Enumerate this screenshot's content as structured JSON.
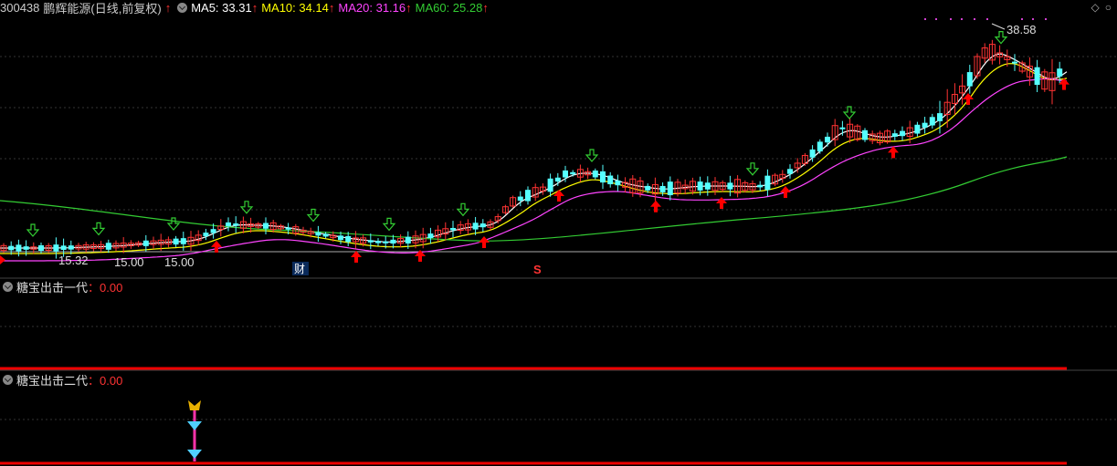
{
  "header": {
    "code": "300438",
    "name": "鹏辉能源",
    "period": "(日线,前复权)",
    "ma5_label": "MA5: 33.31",
    "ma10_label": "MA10: 34.14",
    "ma20_label": "MA20: 31.16",
    "ma60_label": "MA60: 25.28",
    "up_glyph": "↑",
    "colors": {
      "ma5": "#ffffff",
      "ma10": "#ffff00",
      "ma20": "#ff44ff",
      "ma60": "#33cc33"
    }
  },
  "toolbar_icons": {
    "diamond": "◇",
    "circle": "○"
  },
  "price_labels": {
    "high": "38.58",
    "low": "15.32",
    "mid1": "15.00",
    "mid2": "15.00",
    "caibiao": "财",
    "s_mark": "S"
  },
  "pane1": {
    "title": "糖宝出击一代",
    "value": "：0.00"
  },
  "pane2": {
    "title": "糖宝出击二代",
    "value": "：0.00"
  },
  "colors": {
    "up": "#ff3333",
    "down": "#55ffff",
    "bg": "#000000",
    "signal_up": "#ff0000",
    "signal_down": "#33cc33"
  }
}
